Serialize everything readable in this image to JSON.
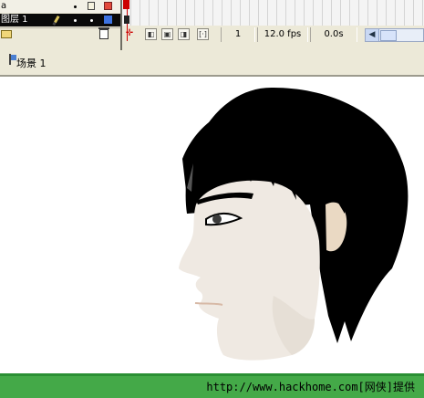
{
  "colors": {
    "playhead": "#cc0000",
    "footer_green": "#44a948",
    "hair": "#000000",
    "skin": "#efe9e2"
  },
  "layers": [
    {
      "name": "a",
      "selected": false
    },
    {
      "name": "图层 1",
      "selected": true
    }
  ],
  "icons": {
    "insert_layer": "folder-icon",
    "delete_layer": "trash-icon",
    "edit_layer": "pencil-icon"
  },
  "timeline": {
    "current_frame": "1",
    "frame_rate": "12.0 fps",
    "elapsed_time": "0.0s"
  },
  "scene": {
    "label": "场景 1"
  },
  "footer": {
    "text": "http://www.hackhome.com[网侠]提供"
  }
}
